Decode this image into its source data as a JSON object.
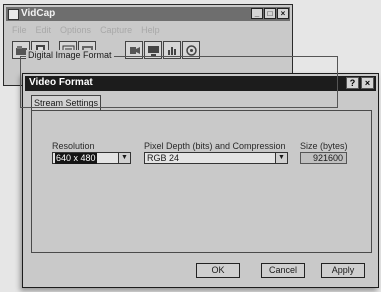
{
  "main_window": {
    "title": "VidCap",
    "controls": {
      "minimize": "_",
      "maximize": "□",
      "close": "×"
    },
    "menu": [
      "File",
      "Edit",
      "Options",
      "Capture",
      "Help"
    ],
    "toolbar_icons": [
      "open-file-icon",
      "film-icon",
      "settings-icon",
      "video-format-icon",
      "video-source-icon",
      "display-icon",
      "audio-format-icon"
    ]
  },
  "dialog": {
    "title": "Video Format",
    "help_button": "?",
    "close_button": "×",
    "tab": "Stream Settings",
    "group_label": "Digital Image Format",
    "resolution": {
      "label": "Resolution",
      "value": "640 x 480"
    },
    "pixel_depth": {
      "label": "Pixel Depth (bits) and Compression",
      "value": "RGB 24"
    },
    "size": {
      "label": "Size (bytes)",
      "value": "921600"
    },
    "buttons": {
      "ok": "OK",
      "cancel": "Cancel",
      "apply": "Apply"
    }
  }
}
